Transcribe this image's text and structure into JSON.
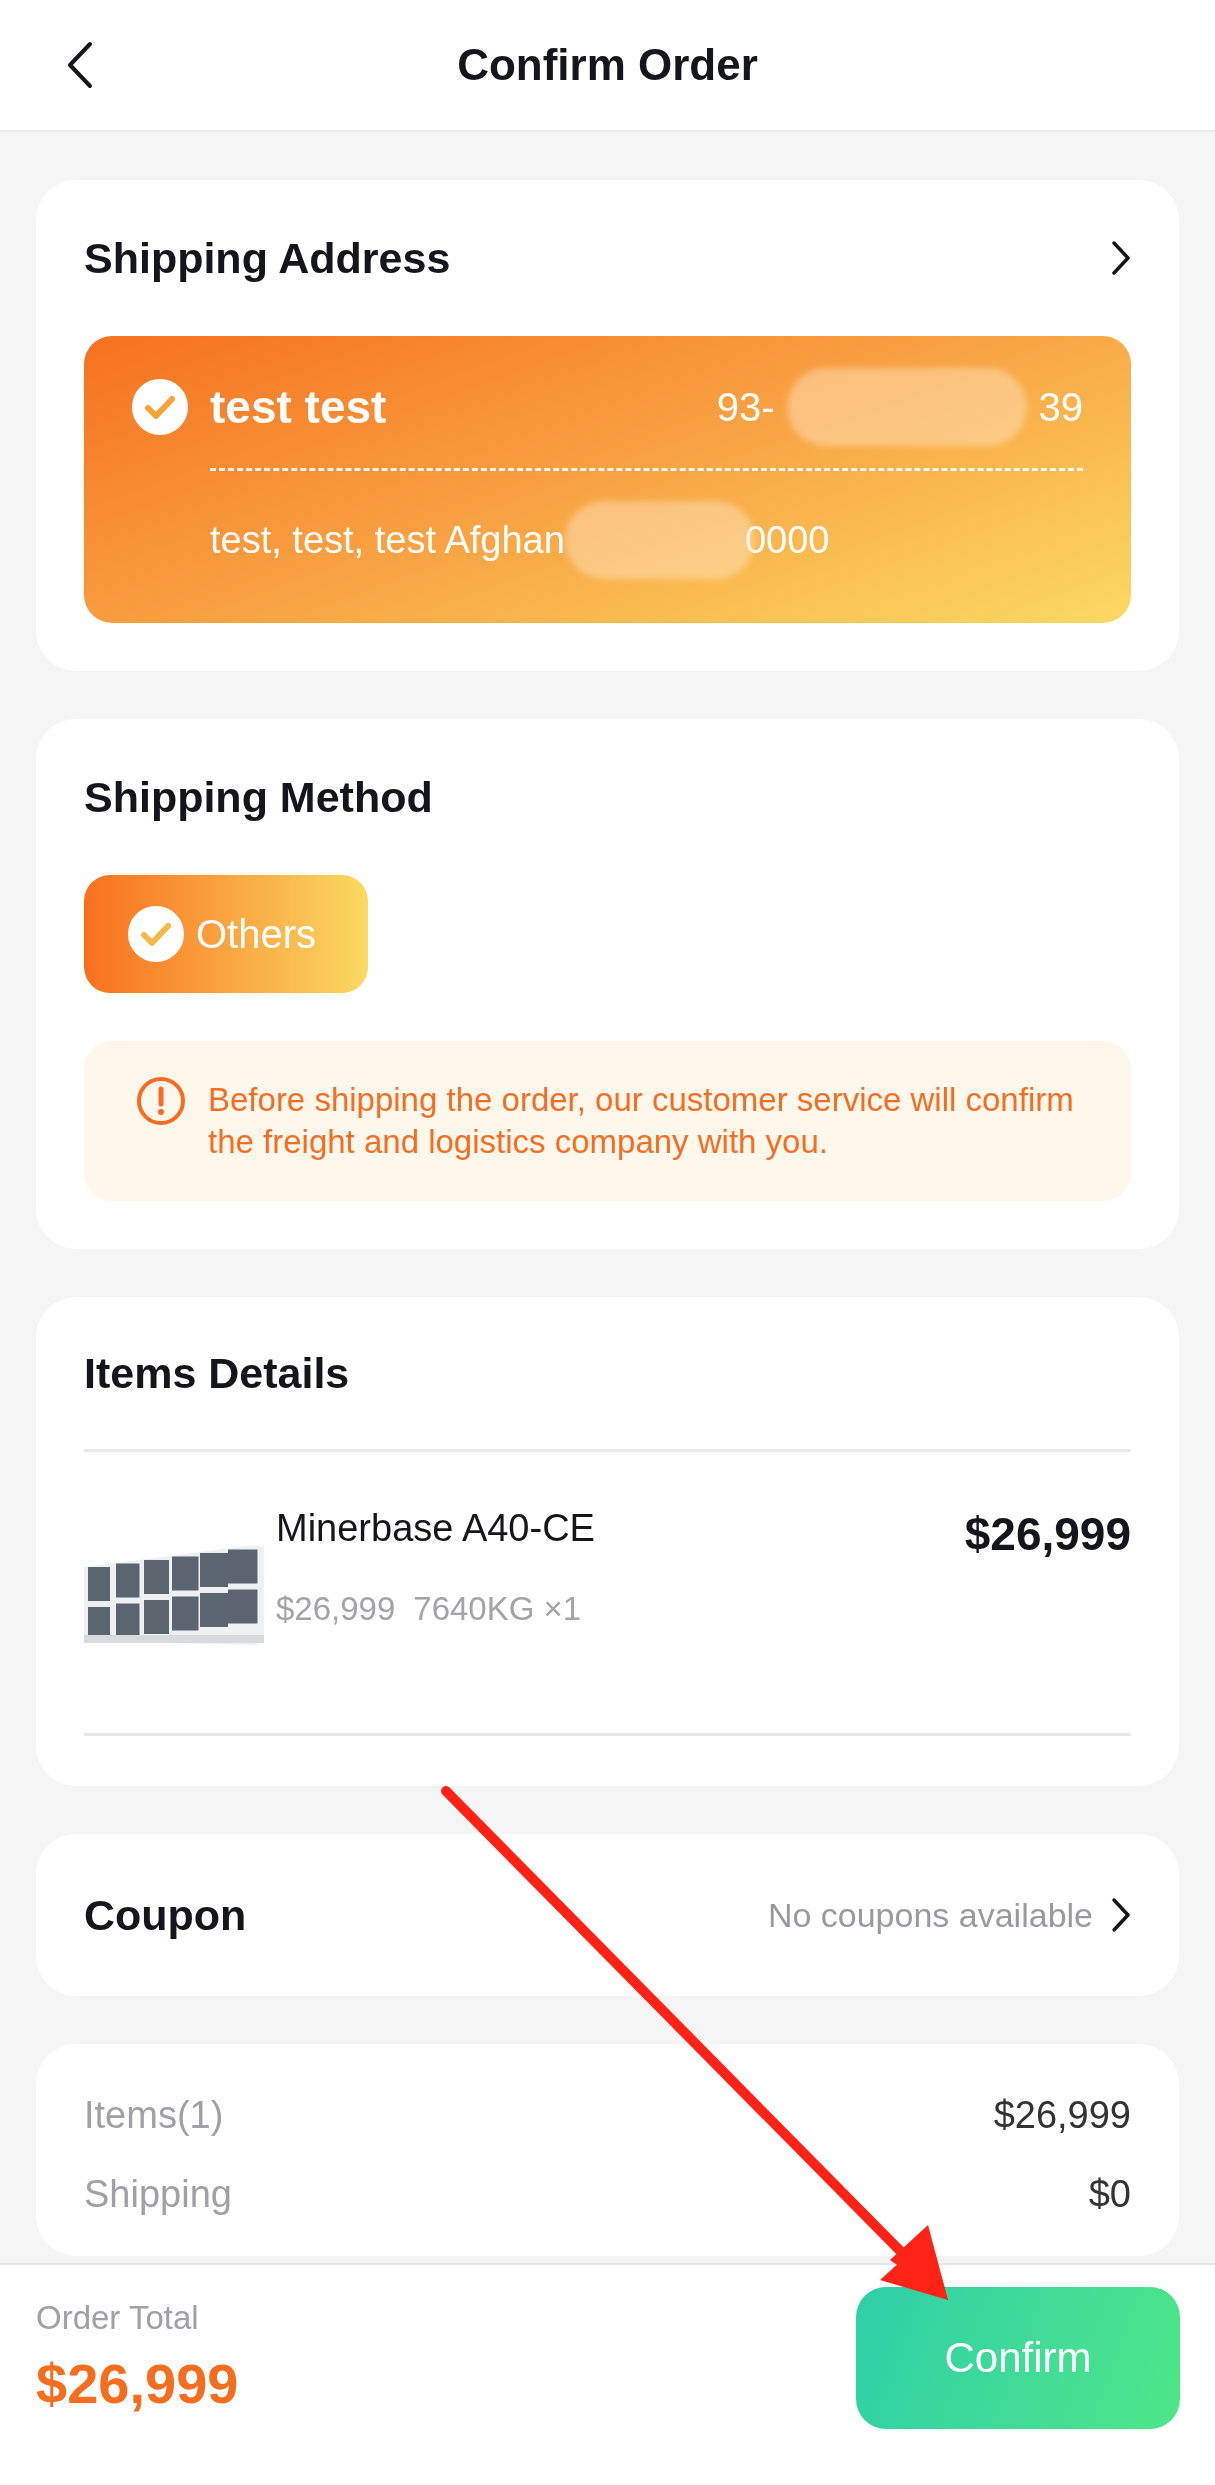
{
  "header": {
    "title": "Confirm Order"
  },
  "address": {
    "title": "Shipping Address",
    "name": "test test",
    "phone_start": "93-",
    "phone_end": "39",
    "line_start": "test, test, test Afghan",
    "line_end": "0000",
    "selected": true
  },
  "shipping": {
    "title": "Shipping Method",
    "options": [
      {
        "label": "Others",
        "selected": true
      }
    ],
    "notice": "Before shipping the order, our customer service will confirm the freight and logistics company with you."
  },
  "items": {
    "title": "Items Details",
    "list": [
      {
        "kind": "picture",
        "name": "Minerbase A40-CE",
        "unit_price": "$26,999",
        "weight_qty": "7640KG ×1",
        "price": "$26,999"
      }
    ]
  },
  "coupon": {
    "title": "Coupon",
    "value": "No coupons available"
  },
  "summary": [
    {
      "label": "Items(1)",
      "value": "$26,999"
    },
    {
      "label": "Shipping",
      "value": "$0"
    }
  ],
  "footer": {
    "total_label": "Order Total",
    "total": "$26,999",
    "button": "Confirm"
  }
}
